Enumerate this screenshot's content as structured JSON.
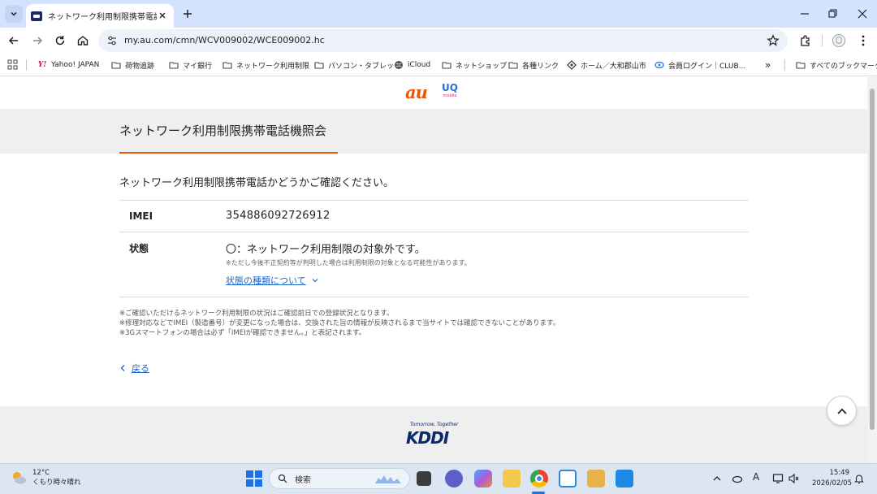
{
  "browser": {
    "tab_title": "ネットワーク利用制限携帯電話機照会",
    "url": "my.au.com/cmn/WCV009002/WCE009002.hc",
    "bookmarks": [
      {
        "label": "Yahoo! JAPAN",
        "icon": "yahoo-icon"
      },
      {
        "label": "荷物追跡",
        "icon": "folder-icon"
      },
      {
        "label": "マイ銀行",
        "icon": "folder-icon"
      },
      {
        "label": "ネットワーク利用制限",
        "icon": "folder-icon"
      },
      {
        "label": "パソコン・タブレット",
        "icon": "folder-icon"
      },
      {
        "label": "iCloud",
        "icon": "globe-icon"
      },
      {
        "label": "ネットショップ",
        "icon": "folder-icon"
      },
      {
        "label": "各種リンク",
        "icon": "folder-icon"
      },
      {
        "label": "ホーム／大和郡山市",
        "icon": "site-icon"
      },
      {
        "label": "会員ログイン｜CLUB...",
        "icon": "site-icon"
      }
    ],
    "all_bookmarks_label": "すべてのブックマーク",
    "overflow_label": "»"
  },
  "page": {
    "logo_au": "au",
    "logo_uq": "UQ",
    "logo_uq_sub": "mobile",
    "title": "ネットワーク利用制限携帯電話機照会",
    "intro": "ネットワーク利用制限携帯電話かどうかご確認ください。",
    "imei_label": "IMEI",
    "imei_value": "354886092726912",
    "status_label": "状態",
    "status_value": "〇：ネットワーク利用制限の対象外です。",
    "status_note": "※ただし今後不正契約等が判明した場合は利用制限の対象となる可能性があります。",
    "status_link": "状態の種類について",
    "notes": [
      "※ご確認いただけるネットワーク利用制限の状況はご確認前日での登録状況となります。",
      "※修理対応などでIMEI（製造番号）が変更になった場合は、交換された旨の情報が反映されるまで当サイトでは確認できないことがあります。",
      "※3Gスマートフォンの場合は必ず「IMEIが確認できません。」と表記されます。"
    ],
    "back_link": "戻る",
    "footer_tagline": "Tomorrow, Together",
    "footer_logo": "KDDI"
  },
  "taskbar": {
    "temperature": "12°C",
    "weather": "くもり時々晴れ",
    "search_placeholder": "検索",
    "time": "15:49",
    "date": "2026/02/05"
  },
  "colors": {
    "accent_orange": "#eb5505",
    "link_blue": "#1a67c4",
    "kddi_navy": "#0a2a6e",
    "chrome_tabstrip": "#d3e3fd"
  }
}
